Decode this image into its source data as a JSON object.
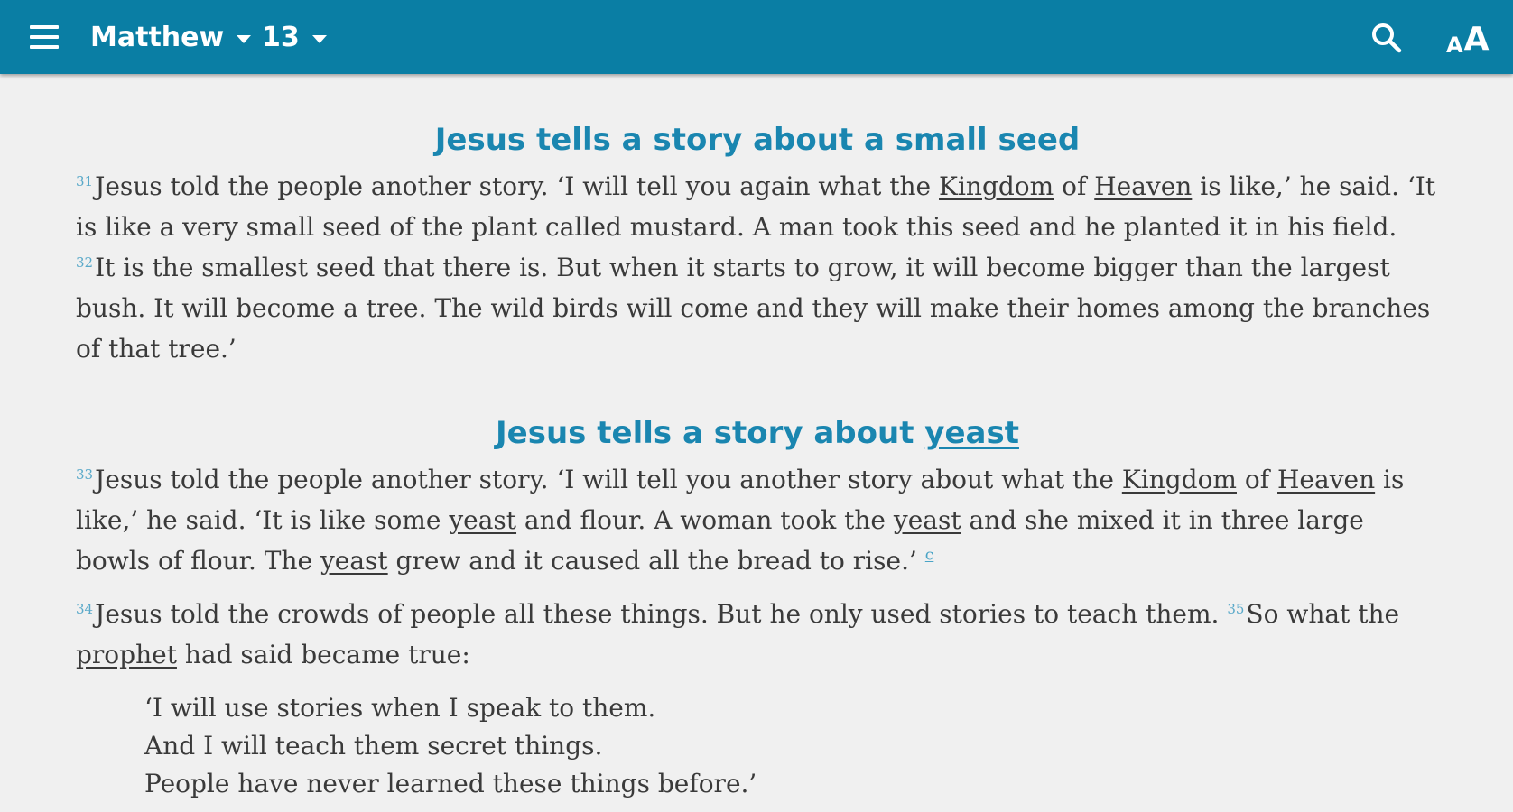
{
  "toolbar": {
    "book": "Matthew",
    "chapter": "13",
    "menu_icon": "hamburger-menu-icon",
    "search_icon": "search-icon",
    "font_icon": "font-size-icon",
    "font_small": "A",
    "font_big": "A",
    "color": "#0a7ea4"
  },
  "sections": [
    {
      "heading_parts": [
        "Jesus tells a story about a small seed"
      ]
    },
    {
      "heading_parts": [
        "Jesus tells a story about ",
        "yeast"
      ]
    }
  ],
  "verses": {
    "v31": {
      "num": "31",
      "t1": "Jesus told the people another story. ‘I will tell you again what the ",
      "link1": "Kingdom",
      "t2": " of ",
      "link2": "Heaven",
      "t3": " is like,’ he said. ‘It is like a very small seed of the plant called mustard. A man took this seed and he planted it in his field. "
    },
    "v32": {
      "num": "32",
      "t1": "It is the smallest seed that there is. But when it starts to grow, it will become bigger than the largest bush. It will become a tree. The wild birds will come and they will make their homes among the branches of that tree.’"
    },
    "v33": {
      "num": "33",
      "t1": "Jesus told the people another story. ‘I will tell you another story about what the ",
      "link1": "Kingdom",
      "t2": " of ",
      "link2": "Heaven",
      "t3": " is like,’ he said. ‘It is like some ",
      "link3": "yeast",
      "t4": " and flour. A woman took the ",
      "link4": "yeast",
      "t5": " and she mixed it in three large bowls of flour. The ",
      "link5": "yeast",
      "t6": " grew and it caused all the bread to rise.’ ",
      "footnote": "c"
    },
    "v34": {
      "num": "34",
      "t1": "Jesus told the crowds of people all these things. But he only used stories to teach them. "
    },
    "v35": {
      "num": "35",
      "t1": "So what the ",
      "link1": "prophet",
      "t2": " had said became true:"
    }
  },
  "poetry": [
    "‘I will use stories when I speak to them.",
    "And I will teach them secret things.",
    "People have never learned these things before.’"
  ]
}
